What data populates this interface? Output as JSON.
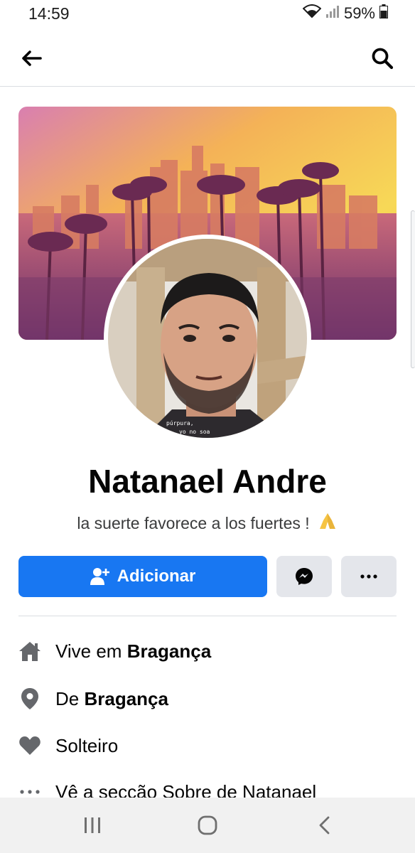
{
  "status_bar": {
    "time": "14:59",
    "battery_percent": "59%"
  },
  "app_bar": {
    "back_icon": "arrow-left-icon",
    "search_icon": "search-icon"
  },
  "profile": {
    "name": "Natanael Andre",
    "bio": "la suerte favorece a los fuertes !",
    "bio_emoji_icon": "folded-hands-icon",
    "avatar_overlay_line1": "púrpura,",
    "avatar_overlay_line2": "yo no soa"
  },
  "actions": {
    "add_friend_label": "Adicionar",
    "add_friend_icon": "person-plus-icon",
    "messenger_icon": "messenger-icon",
    "more_icon": "more-icon"
  },
  "intro": {
    "lives_prefix": "Vive em ",
    "lives_place": "Bragança",
    "from_prefix": "De ",
    "from_place": "Bragança",
    "relationship": "Solteiro",
    "about_link": "Vê a secção Sobre de Natanael"
  },
  "colors": {
    "primary": "#1877f2",
    "button_grey": "#e4e6eb",
    "icon_grey": "#65676b"
  }
}
